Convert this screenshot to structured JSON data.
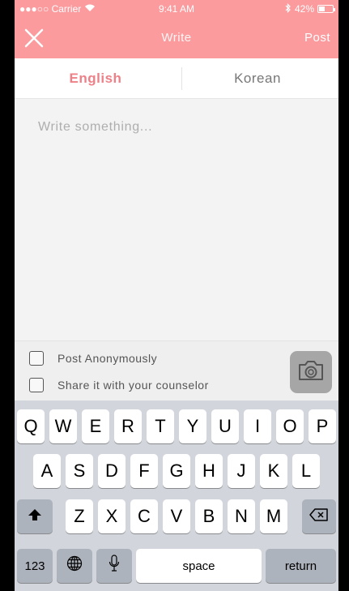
{
  "status_bar": {
    "carrier": "●●●○○ Carrier",
    "time": "9:41 AM",
    "battery": "42%",
    "battery_fraction": 0.42
  },
  "nav": {
    "title": "Write",
    "post": "Post",
    "close_icon": "close-icon"
  },
  "languages": {
    "english": "English",
    "korean": "Korean",
    "selected": "English"
  },
  "compose": {
    "placeholder": "Write something..."
  },
  "options": {
    "anonymous": "Post Anonymously",
    "counselor": "Share it with your counselor",
    "anonymous_checked": false,
    "counselor_checked": false
  },
  "keyboard": {
    "row1": [
      "Q",
      "W",
      "E",
      "R",
      "T",
      "Y",
      "U",
      "I",
      "O",
      "P"
    ],
    "row2": [
      "A",
      "S",
      "D",
      "F",
      "G",
      "H",
      "J",
      "K",
      "L"
    ],
    "row3": [
      "Z",
      "X",
      "C",
      "V",
      "B",
      "N",
      "M"
    ],
    "numbers": "123",
    "space": "space",
    "return": "return"
  },
  "colors": {
    "accent": "#fb9b9e",
    "active_tab": "#ee8087"
  }
}
